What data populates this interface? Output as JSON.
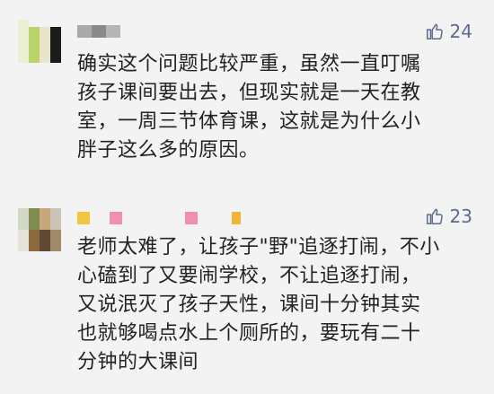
{
  "comments": [
    {
      "likes": "24",
      "text": "确实这个问题比较严重，虽然一直叮嘱\n孩子课间要出去，但现实就是一天在教\n室，一周三节体育课，这就是为什么小\n胖子这么多的原因。",
      "colors": {
        "avatar": [
          "#b8d36a",
          "#1b1b1b",
          "#e8e3c9",
          "#9dbb53"
        ],
        "name": "#9b9b9b"
      }
    },
    {
      "likes": "23",
      "text": "老师太难了，让孩子\"野\"追逐打闹，不小\n心磕到了又要闹学校，不让追逐打闹，\n又说泯灭了孩子天性，课间十分钟其实\n也就够喝点水上个厕所的，要玩有二十\n分钟的大课间",
      "colors": {
        "avatar": [
          "#8b6a3e",
          "#c8c2b7",
          "#7e8c4d",
          "#5e4a32"
        ],
        "name_blocks": [
          "#f0c544",
          "#f08fb0",
          "#f08fb0",
          "#f0b43a"
        ]
      }
    }
  ],
  "icons": {
    "like": "thumbs-up-icon"
  }
}
